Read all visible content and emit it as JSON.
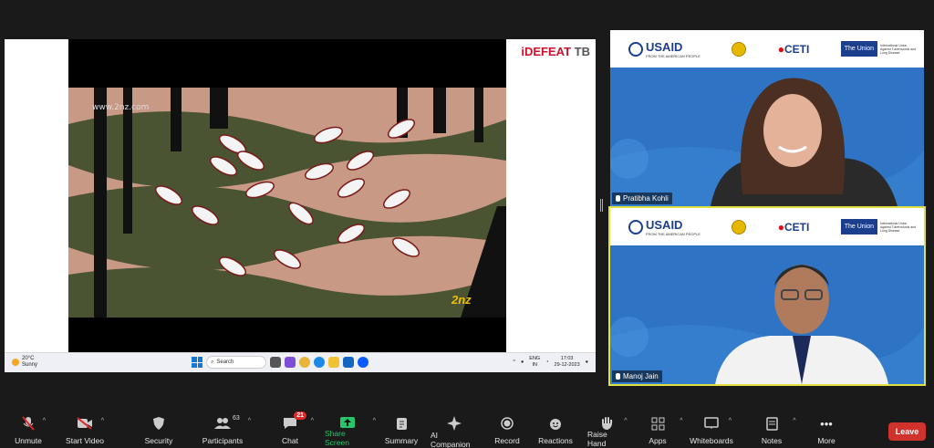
{
  "share": {
    "brand_main": "iDEFEAT",
    "brand_tb": "TB",
    "watermark": "www.2nz.com",
    "logo_2nz": "2nz",
    "taskbar": {
      "weather_temp": "20°C",
      "weather_desc": "Sunny",
      "search_placeholder": "Search",
      "lang": "ENG",
      "lang_region": "IN",
      "time": "17:03",
      "date": "29-12-2023"
    }
  },
  "tiles": [
    {
      "name": "Pratibha Kohli",
      "banner": {
        "usaid": "USAID",
        "usaid_sub": "FROM THE AMERICAN PEOPLE",
        "ceti": "CETI",
        "union": "The Union",
        "union_text": "International Union Against Tuberculosis and Lung Disease"
      }
    },
    {
      "name": "Manoj Jain",
      "banner": {
        "usaid": "USAID",
        "usaid_sub": "FROM THE AMERICAN PEOPLE",
        "ceti": "CETI",
        "union": "The Union",
        "union_text": "International Union Against Tuberculosis and Lung Disease"
      }
    }
  ],
  "toolbar": {
    "unmute": "Unmute",
    "start_video": "Start Video",
    "security": "Security",
    "participants": "Participants",
    "participants_count": "63",
    "chat": "Chat",
    "chat_badge": "21",
    "share_screen": "Share Screen",
    "summary": "Summary",
    "ai_companion": "AI Companion",
    "record": "Record",
    "reactions": "Reactions",
    "raise_hand": "Raise Hand",
    "apps": "Apps",
    "whiteboards": "Whiteboards",
    "notes": "Notes",
    "more": "More",
    "leave": "Leave"
  },
  "colors": {
    "accent_green": "#26c46b",
    "leave_red": "#d0332c",
    "active_speaker": "#e2df40"
  }
}
